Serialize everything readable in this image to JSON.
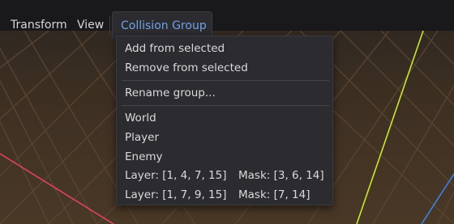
{
  "menubar": {
    "items": [
      {
        "label": "Transform"
      },
      {
        "label": "View"
      },
      {
        "label": "Collision Group"
      }
    ]
  },
  "dropdown": {
    "actions": [
      {
        "label": "Add from selected"
      },
      {
        "label": "Remove from selected"
      },
      {
        "label": "Rename group..."
      }
    ],
    "groups": [
      {
        "label": "World"
      },
      {
        "label": "Player"
      },
      {
        "label": "Enemy"
      }
    ],
    "layer_masks": [
      {
        "layer": "Layer: [1, 4, 7, 15]",
        "mask": "Mask: [3, 6, 14]"
      },
      {
        "layer": "Layer: [1, 7, 9, 15]",
        "mask": "Mask: [7, 14]"
      }
    ]
  },
  "viewport": {
    "background_color": "#3f3022",
    "grid_color": "#5a4632",
    "axis_colors": {
      "red_axis": "#e0435a",
      "yellow_axis": "#c8e632",
      "blue_axis": "#3a82e6"
    }
  }
}
